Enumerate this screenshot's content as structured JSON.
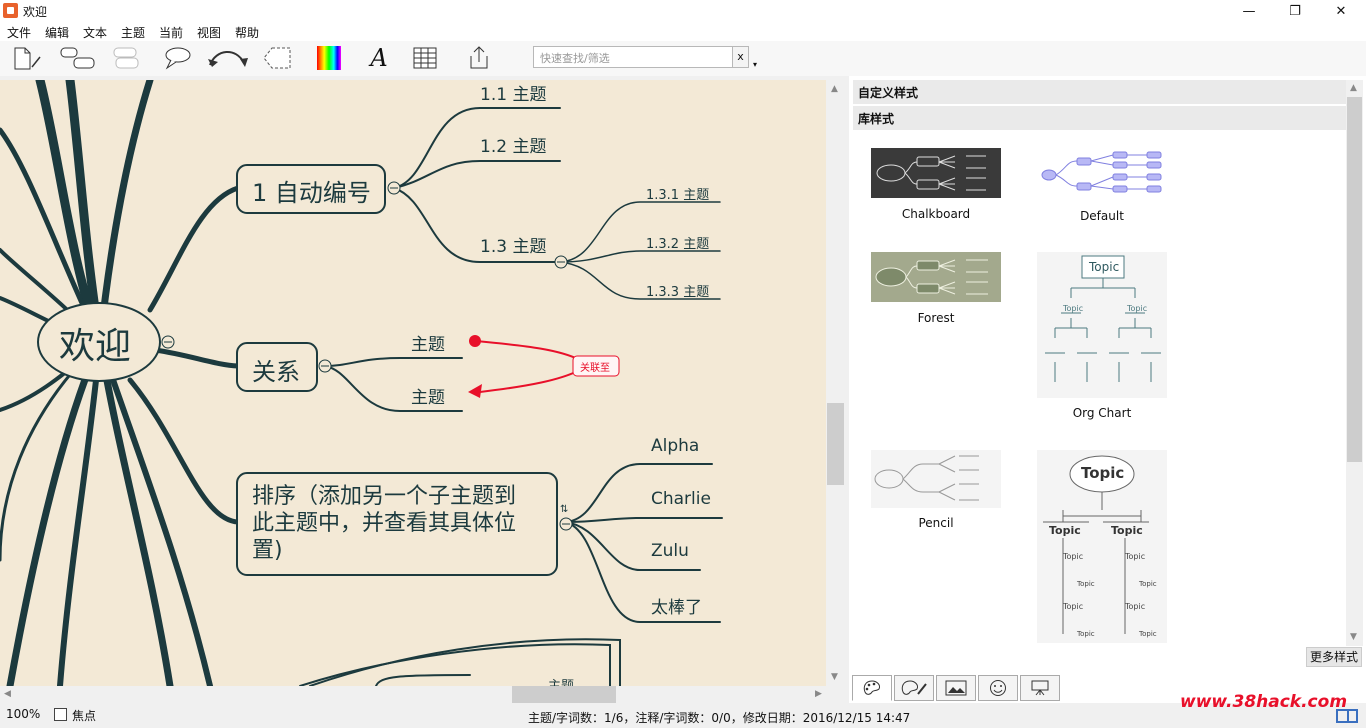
{
  "window": {
    "title": "欢迎",
    "min": "—",
    "max": "❐",
    "close": "✕"
  },
  "menu": [
    "文件",
    "编辑",
    "文本",
    "主题",
    "当前",
    "视图",
    "帮助"
  ],
  "toolbar": {
    "icons": [
      "new-doc-icon",
      "topic-icon",
      "subtopic-icon",
      "callout-icon",
      "relationship-icon",
      "boundary-icon",
      "color-icon",
      "font-icon",
      "table-icon",
      "export-icon"
    ],
    "font_glyph": "A",
    "search_placeholder": "快速查找/筛选",
    "search_clear": "x",
    "search_dropdown": "▾"
  },
  "mindmap": {
    "central": "欢迎",
    "branch1": {
      "label": "1 自动编号",
      "children": [
        "1.1 主题",
        "1.2 主题",
        "1.3 主题"
      ],
      "sub": [
        "1.3.1 主题",
        "1.3.2 主题",
        "1.3.3 主题"
      ]
    },
    "branch2": {
      "label": "关系",
      "children": [
        "主题",
        "主题"
      ],
      "relation": "关联至"
    },
    "branch3": {
      "label_lines": [
        "排序（添加另一个子主题到",
        "此主题中，并查看其具体位",
        "置)"
      ],
      "sort_mark": "⇅",
      "children": [
        "Alpha",
        "Charlie",
        "Zulu",
        "太棒了"
      ]
    },
    "bottom_topic": "主题",
    "collapse_glyph": "⊖"
  },
  "panel": {
    "custom_styles": "自定义样式",
    "library_styles": "库样式",
    "styles": [
      {
        "name": "Chalkboard"
      },
      {
        "name": "Default"
      },
      {
        "name": "Forest"
      },
      {
        "name": "Org Chart"
      },
      {
        "name": "Pencil"
      }
    ],
    "thumb_text": "Topic",
    "more_button": "更多样式",
    "tabs": [
      "style-tab-icon",
      "theme-tab-icon",
      "image-tab-icon",
      "emoji-tab-icon",
      "presentation-tab-icon"
    ]
  },
  "status": {
    "zoom": "100%",
    "focus_label": "焦点",
    "info": "主题/字词数：1/6，注释/字词数：0/0，修改日期：2016/12/15 14:47"
  },
  "watermark": "www.38hack.com",
  "colors": {
    "canvas_bg": "#f3e9d6",
    "branch": "#1c3a3e",
    "relation": "#e8102a"
  }
}
